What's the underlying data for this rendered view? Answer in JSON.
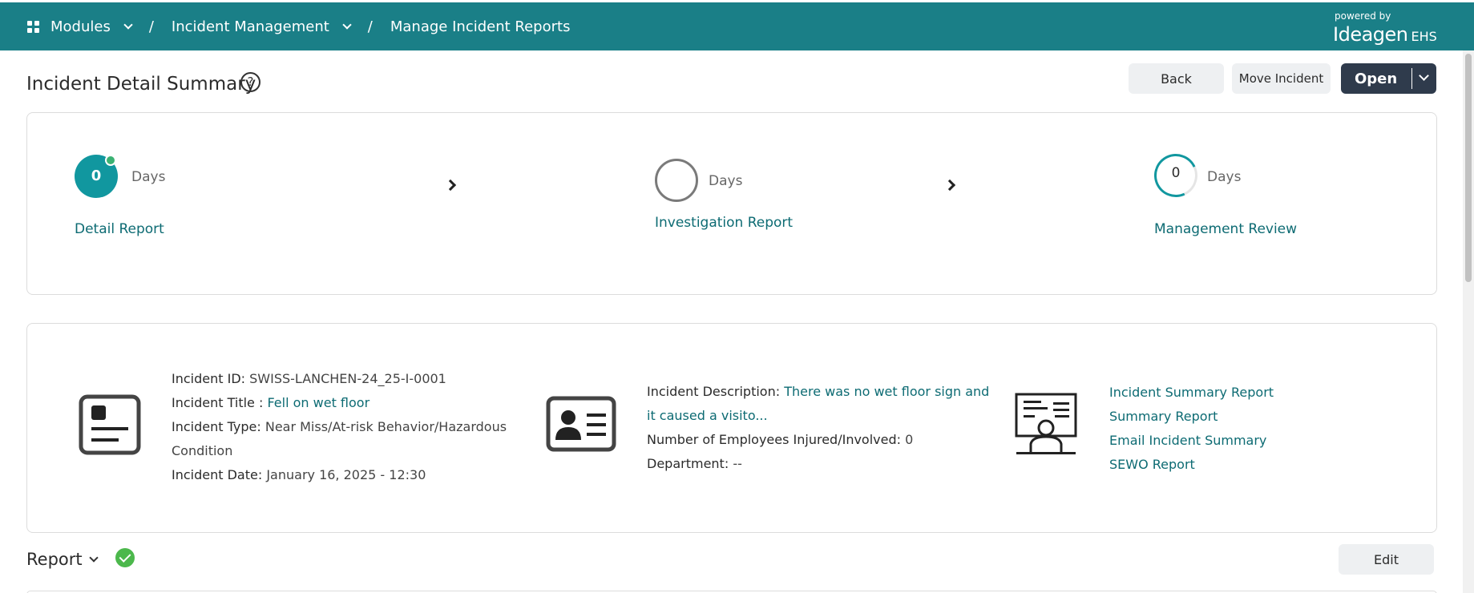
{
  "breadcrumb": {
    "modules": "Modules",
    "incident_management": "Incident Management",
    "current": "Manage Incident Reports",
    "separator": "/"
  },
  "brand": {
    "powered_by": "powered by",
    "name": "Ideagen",
    "product": "EHS"
  },
  "header": {
    "title": "Incident Detail Summary",
    "help": "?",
    "back_label": "Back",
    "move_label": "Move Incident",
    "open_label": "Open"
  },
  "stages": [
    {
      "count": "0",
      "days_label": "Days",
      "label": "Detail Report",
      "status": "completed"
    },
    {
      "count": "",
      "days_label": "Days",
      "label": "Investigation Report",
      "status": "pending"
    },
    {
      "count": "0",
      "days_label": "Days",
      "label": "Management Review",
      "status": "in-progress"
    }
  ],
  "incident": {
    "id_label": "Incident ID:",
    "id_value": "SWISS-LANCHEN-24_25-I-0001",
    "title_label": "Incident Title :",
    "title_value": "Fell on wet floor",
    "type_label": "Incident Type:",
    "type_value_line1": "Near Miss/At-risk Behavior/Hazardous",
    "type_value_line2": "Condition",
    "date_label": "Incident Date:",
    "date_value": "January 16, 2025 - 12:30",
    "description_label": "Incident Description:",
    "description_line1": "There was no wet floor sign and",
    "description_line2": "it caused a visito...",
    "employees_label": "Number of Employees Injured/Involved:",
    "employees_value": "0",
    "department_label": "Department:",
    "department_value": "--"
  },
  "reports": [
    "Incident Summary Report",
    "Summary Report",
    "Email Incident Summary",
    "SEWO Report"
  ],
  "report_section": {
    "title": "Report",
    "edit_label": "Edit"
  },
  "colors": {
    "topbar": "#1a7f87",
    "accent": "#11979f",
    "link": "#0d6b73",
    "primary_button": "#2f3b4c",
    "success": "#4cb84c"
  }
}
